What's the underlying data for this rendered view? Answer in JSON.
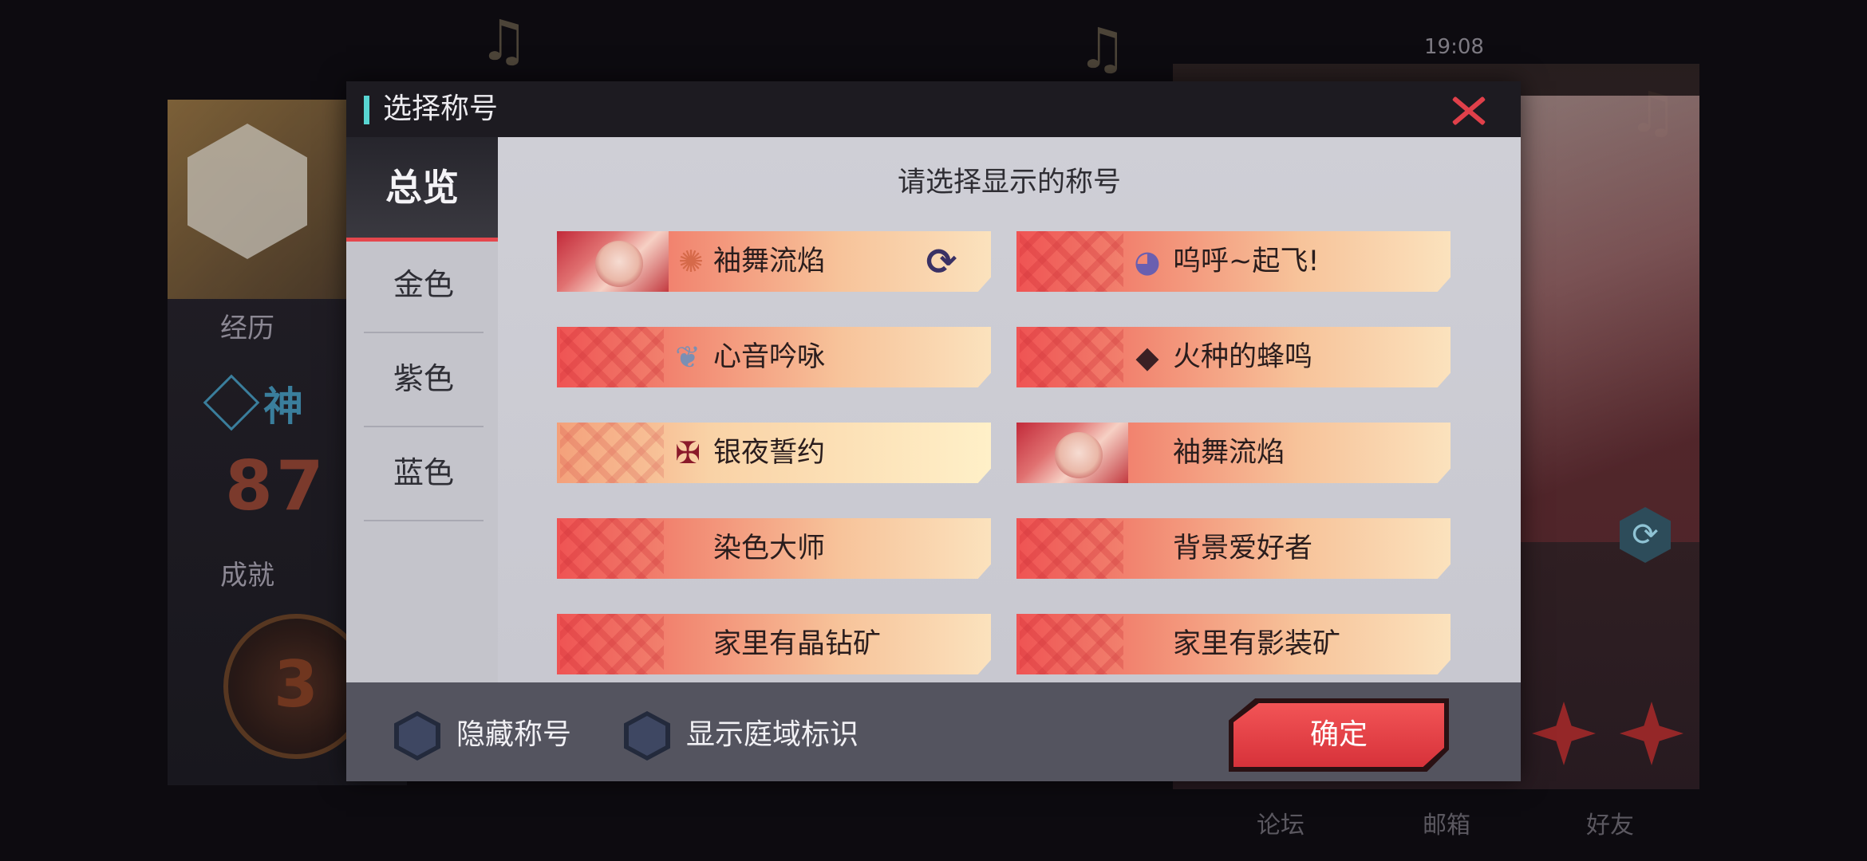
{
  "background": {
    "status_time": "19:08",
    "left_labels": {
      "experience": "经历",
      "achievement": "成就"
    },
    "god_label": "神",
    "stat_number": "87",
    "medal_number": "3",
    "nav_items": [
      "论坛",
      "邮箱",
      "好友"
    ]
  },
  "modal": {
    "title": "选择称号",
    "close_icon": "close-icon",
    "prompt": "请选择显示的称号",
    "tabs": [
      {
        "label": "总览",
        "active": true
      },
      {
        "label": "金色",
        "active": false
      },
      {
        "label": "紫色",
        "active": false
      },
      {
        "label": "蓝色",
        "active": false
      }
    ],
    "titles": [
      {
        "label": "袖舞流焰",
        "style": "portrait",
        "emblem": "sun-emblem-icon",
        "current": true
      },
      {
        "label": "呜呼~起飞!",
        "style": "pattern",
        "emblem": "ghost-emblem-icon",
        "current": false
      },
      {
        "label": "心音吟咏",
        "style": "pattern",
        "emblem": "bird-emblem-icon",
        "current": false
      },
      {
        "label": "火种的蜂鸣",
        "style": "pattern",
        "emblem": "device-emblem-icon",
        "current": false
      },
      {
        "label": "银夜誓约",
        "style": "silver",
        "emblem": "cross-emblem-icon",
        "current": false
      },
      {
        "label": "袖舞流焰",
        "style": "portrait",
        "emblem": "",
        "current": false
      },
      {
        "label": "染色大师",
        "style": "pattern",
        "emblem": "",
        "current": false
      },
      {
        "label": "背景爱好者",
        "style": "pattern",
        "emblem": "",
        "current": false
      },
      {
        "label": "家里有晶钻矿",
        "style": "pattern",
        "emblem": "",
        "current": false
      },
      {
        "label": "家里有影装矿",
        "style": "pattern",
        "emblem": "",
        "current": false
      }
    ],
    "footer": {
      "hide_title_label": "隐藏称号",
      "show_domain_label": "显示庭域标识",
      "confirm_label": "确定"
    },
    "colors": {
      "accent_red": "#e5474d",
      "header_bar": "#58d5d2"
    }
  }
}
